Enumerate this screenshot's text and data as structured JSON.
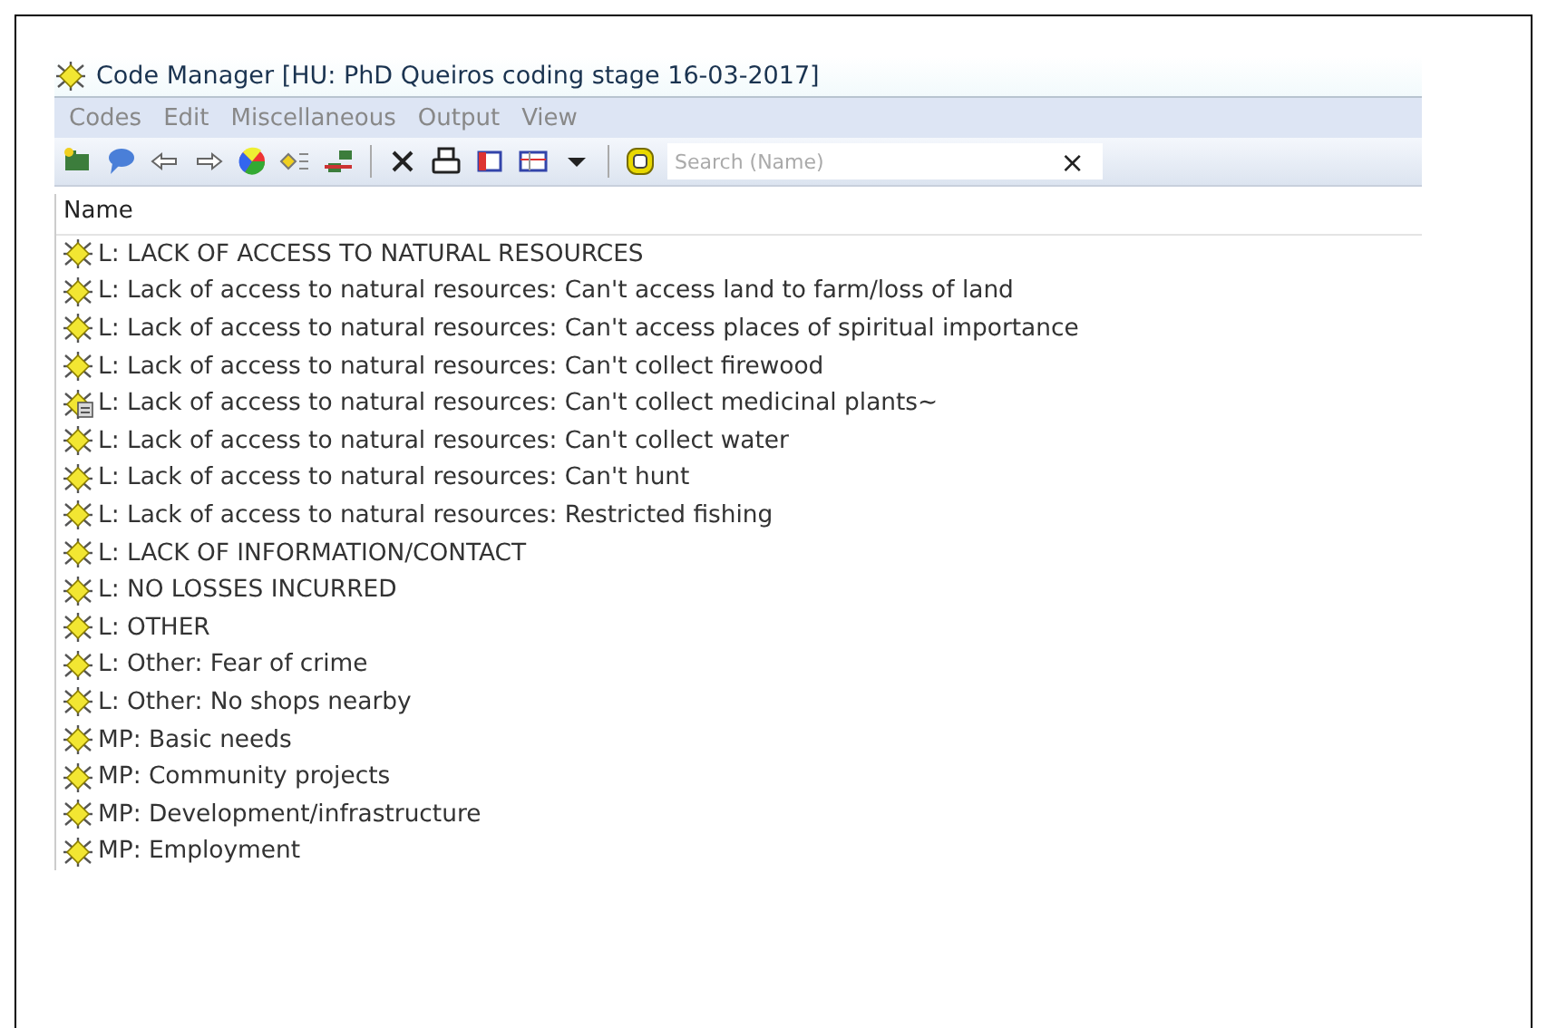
{
  "window": {
    "title": "Code Manager [HU: PhD Queiros coding stage 16-03-2017]"
  },
  "menu": [
    "Codes",
    "Edit",
    "Miscellaneous",
    "Output",
    "View"
  ],
  "search": {
    "placeholder": "Search (Name)",
    "clear": "×"
  },
  "table": {
    "columns": [
      "Name"
    ],
    "rows": [
      {
        "kind": "code",
        "name": "L: LACK OF ACCESS TO NATURAL RESOURCES"
      },
      {
        "kind": "code",
        "name": "L: Lack of access to natural resources: Can't access land to farm/loss of land"
      },
      {
        "kind": "code",
        "name": "L: Lack of access to natural resources: Can't access places of spiritual importance"
      },
      {
        "kind": "code",
        "name": "L: Lack of access to natural resources: Can't collect firewood"
      },
      {
        "kind": "memo",
        "name": "L: Lack of access to natural resources: Can't collect medicinal plants~"
      },
      {
        "kind": "code",
        "name": "L: Lack of access to natural resources: Can't collect water"
      },
      {
        "kind": "code",
        "name": "L: Lack of access to natural resources: Can't hunt"
      },
      {
        "kind": "code",
        "name": "L: Lack of access to natural resources: Restricted fishing"
      },
      {
        "kind": "code",
        "name": "L: LACK OF INFORMATION/CONTACT"
      },
      {
        "kind": "code",
        "name": "L: NO LOSSES INCURRED"
      },
      {
        "kind": "code",
        "name": "L: OTHER"
      },
      {
        "kind": "code",
        "name": "L: Other: Fear of crime"
      },
      {
        "kind": "code",
        "name": "L: Other: No shops nearby"
      },
      {
        "kind": "code",
        "name": "MP: Basic needs"
      },
      {
        "kind": "code",
        "name": "MP: Community projects"
      },
      {
        "kind": "code",
        "name": "MP: Development/infrastructure"
      },
      {
        "kind": "code",
        "name": "MP: Employment"
      }
    ]
  }
}
